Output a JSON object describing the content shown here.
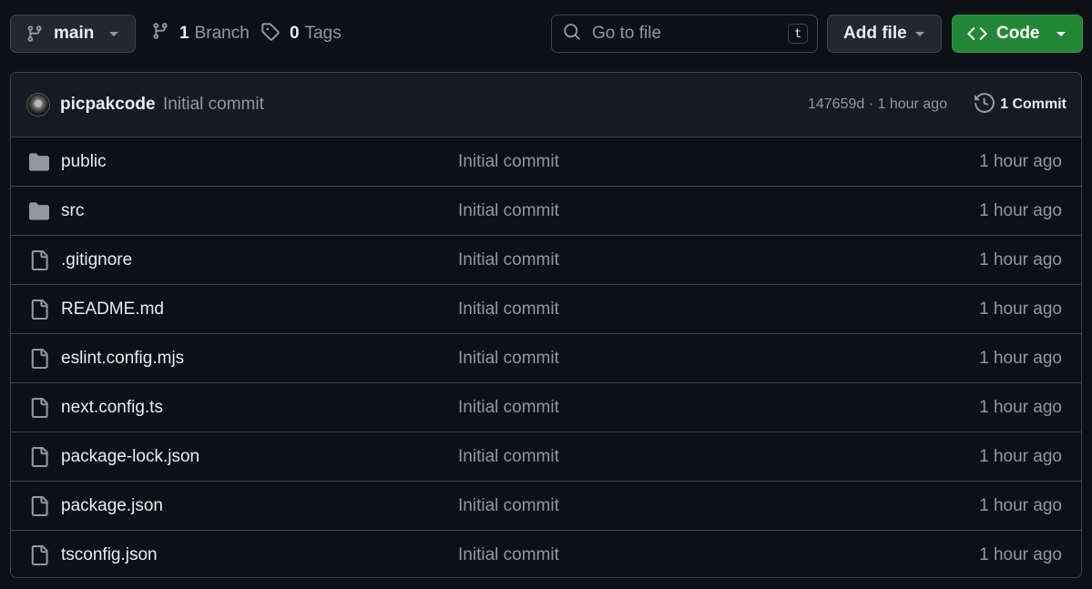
{
  "toolbar": {
    "branch_label": "main",
    "branch_count": "1",
    "branch_text": "Branch",
    "tag_count": "0",
    "tag_text": "Tags",
    "search_placeholder": "Go to file",
    "search_shortcut": "t",
    "add_file_label": "Add file",
    "code_label": "Code"
  },
  "colors": {
    "background": "#0d1117",
    "code_button": "#238636",
    "border": "#3d444d",
    "muted_text": "#9198a1"
  },
  "latest_commit": {
    "author": "picpakcode",
    "message": "Initial commit",
    "meta": "147659d · 1 hour ago",
    "commits_label": "1 Commit"
  },
  "files": [
    {
      "name": "public",
      "type": "folder",
      "icon": "folder-icon",
      "message": "Initial commit",
      "time": "1 hour ago"
    },
    {
      "name": "src",
      "type": "folder",
      "icon": "folder-icon",
      "message": "Initial commit",
      "time": "1 hour ago"
    },
    {
      "name": ".gitignore",
      "type": "file",
      "icon": "file-icon",
      "message": "Initial commit",
      "time": "1 hour ago"
    },
    {
      "name": "README.md",
      "type": "file",
      "icon": "file-icon",
      "message": "Initial commit",
      "time": "1 hour ago"
    },
    {
      "name": "eslint.config.mjs",
      "type": "file",
      "icon": "file-icon",
      "message": "Initial commit",
      "time": "1 hour ago"
    },
    {
      "name": "next.config.ts",
      "type": "file",
      "icon": "file-icon",
      "message": "Initial commit",
      "time": "1 hour ago"
    },
    {
      "name": "package-lock.json",
      "type": "file",
      "icon": "file-icon",
      "message": "Initial commit",
      "time": "1 hour ago"
    },
    {
      "name": "package.json",
      "type": "file",
      "icon": "file-icon",
      "message": "Initial commit",
      "time": "1 hour ago"
    },
    {
      "name": "tsconfig.json",
      "type": "file",
      "icon": "file-icon",
      "message": "Initial commit",
      "time": "1 hour ago"
    }
  ]
}
